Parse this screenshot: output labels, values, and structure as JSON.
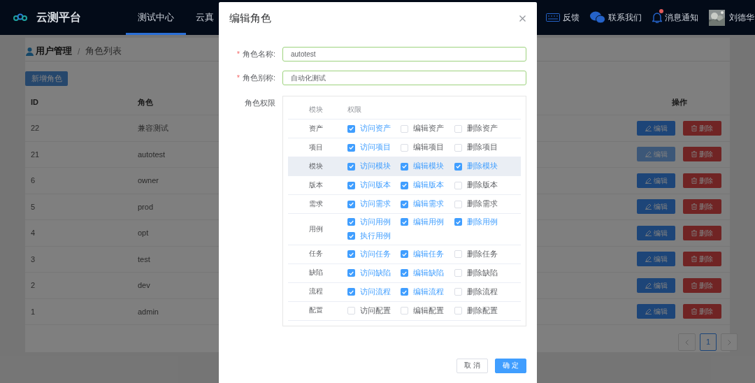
{
  "header": {
    "logo_text": "云测平台",
    "nav": [
      {
        "label": "测试中心",
        "selected": true
      },
      {
        "label": "云真",
        "selected": false
      }
    ],
    "actions": [
      {
        "kind": "keyboard",
        "label": "反馈",
        "badge": false
      },
      {
        "kind": "chat",
        "label": "联系我们",
        "badge": false
      },
      {
        "kind": "bell",
        "label": "消息通知",
        "badge": true
      }
    ],
    "user": {
      "name": "刘德华"
    }
  },
  "breadcrumb": [
    "用户管理",
    "角色列表"
  ],
  "breadcrumb_separator": "/",
  "add_button": "新增角色",
  "table": {
    "columns": [
      "ID",
      "角色",
      "操作"
    ],
    "rows": [
      {
        "id": "22",
        "role": "兼容测试",
        "edit": "编辑",
        "delete": "删除",
        "edit_hovered": false
      },
      {
        "id": "21",
        "role": "autotest",
        "edit": "编辑",
        "delete": "删除",
        "edit_hovered": true
      },
      {
        "id": "6",
        "role": "owner",
        "edit": "编辑",
        "delete": "删除",
        "edit_hovered": false
      },
      {
        "id": "5",
        "role": "prod",
        "edit": "编辑",
        "delete": "删除",
        "edit_hovered": false
      },
      {
        "id": "4",
        "role": "opt",
        "edit": "编辑",
        "delete": "删除",
        "edit_hovered": false
      },
      {
        "id": "3",
        "role": "test",
        "edit": "编辑",
        "delete": "删除",
        "edit_hovered": false
      },
      {
        "id": "2",
        "role": "dev",
        "edit": "编辑",
        "delete": "删除",
        "edit_hovered": false
      },
      {
        "id": "1",
        "role": "admin",
        "edit": "编辑",
        "delete": "删除",
        "edit_hovered": false
      }
    ]
  },
  "pagination": {
    "pages": [
      {
        "label": "1",
        "selected": true
      }
    ]
  },
  "dialog": {
    "title": "编辑角色",
    "required_mark": "*",
    "fields": [
      {
        "label": "角色名称:",
        "required": true,
        "value": "autotest"
      },
      {
        "label": "角色别称:",
        "required": true,
        "value": "自动化测试"
      }
    ],
    "permissions": {
      "label": "角色权限",
      "columns": [
        "模块",
        "权限"
      ],
      "rows": [
        {
          "module": "资产",
          "hovered": false,
          "perms": [
            {
              "label": "访问资产",
              "checked": true
            },
            {
              "label": "编辑资产",
              "checked": false
            },
            {
              "label": "删除资产",
              "checked": false
            }
          ]
        },
        {
          "module": "项目",
          "hovered": false,
          "perms": [
            {
              "label": "访问项目",
              "checked": true
            },
            {
              "label": "编辑项目",
              "checked": false
            },
            {
              "label": "删除项目",
              "checked": false
            }
          ]
        },
        {
          "module": "模块",
          "hovered": true,
          "perms": [
            {
              "label": "访问模块",
              "checked": true
            },
            {
              "label": "编辑模块",
              "checked": true
            },
            {
              "label": "删除模块",
              "checked": true
            }
          ]
        },
        {
          "module": "版本",
          "hovered": false,
          "perms": [
            {
              "label": "访问版本",
              "checked": true
            },
            {
              "label": "编辑版本",
              "checked": true
            },
            {
              "label": "删除版本",
              "checked": false
            }
          ]
        },
        {
          "module": "需求",
          "hovered": false,
          "perms": [
            {
              "label": "访问需求",
              "checked": true
            },
            {
              "label": "编辑需求",
              "checked": true
            },
            {
              "label": "删除需求",
              "checked": false
            }
          ]
        },
        {
          "module": "用例",
          "hovered": false,
          "perms": [
            {
              "label": "访问用例",
              "checked": true
            },
            {
              "label": "编辑用例",
              "checked": true
            },
            {
              "label": "删除用例",
              "checked": true
            },
            {
              "label": "执行用例",
              "checked": true
            }
          ]
        },
        {
          "module": "任务",
          "hovered": false,
          "perms": [
            {
              "label": "访问任务",
              "checked": true
            },
            {
              "label": "编辑任务",
              "checked": true
            },
            {
              "label": "删除任务",
              "checked": false
            }
          ]
        },
        {
          "module": "缺陷",
          "hovered": false,
          "perms": [
            {
              "label": "访问缺陷",
              "checked": true
            },
            {
              "label": "编辑缺陷",
              "checked": true
            },
            {
              "label": "删除缺陷",
              "checked": false
            }
          ]
        },
        {
          "module": "流程",
          "hovered": false,
          "perms": [
            {
              "label": "访问流程",
              "checked": true
            },
            {
              "label": "编辑流程",
              "checked": true
            },
            {
              "label": "删除流程",
              "checked": false
            }
          ]
        },
        {
          "module": "配置",
          "hovered": false,
          "perms": [
            {
              "label": "访问配置",
              "checked": false
            },
            {
              "label": "编辑配置",
              "checked": false
            },
            {
              "label": "删除配置",
              "checked": false
            }
          ]
        }
      ]
    },
    "buttons": [
      {
        "kind": "secondary",
        "label": "取 消"
      },
      {
        "kind": "primary",
        "label": "确 定"
      }
    ]
  }
}
